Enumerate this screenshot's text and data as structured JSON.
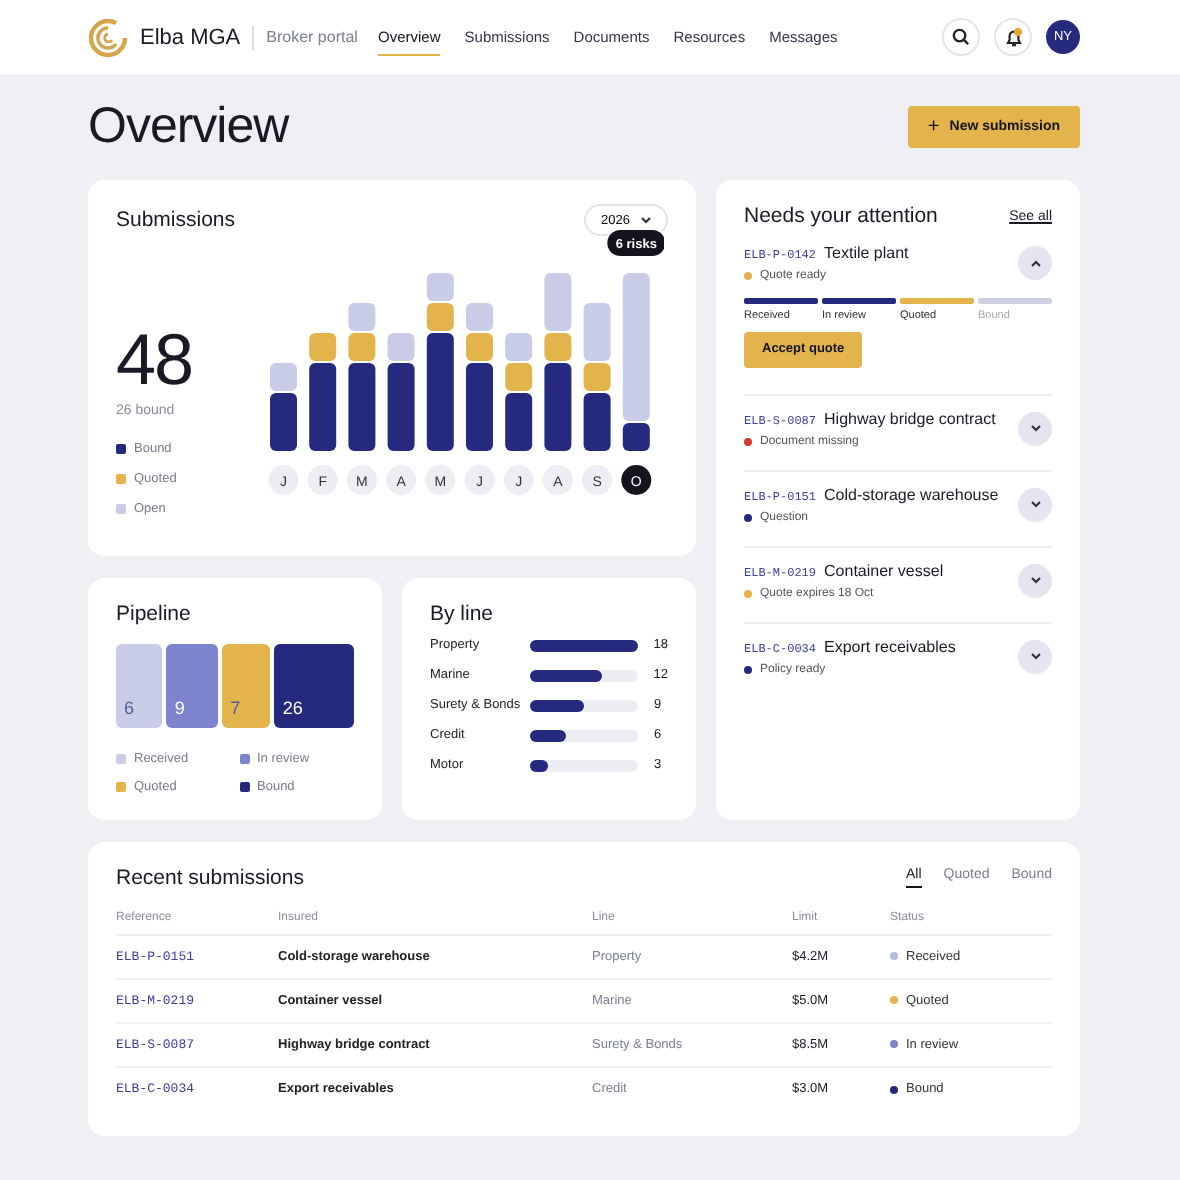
{
  "header": {
    "brand": "Elba MGA",
    "portal": "Broker portal",
    "nav": [
      {
        "label": "Overview",
        "selected": true
      },
      {
        "label": "Submissions",
        "selected": false
      },
      {
        "label": "Documents",
        "selected": false
      },
      {
        "label": "Resources",
        "selected": false
      },
      {
        "label": "Messages",
        "selected": false
      }
    ],
    "notifications_unread": true,
    "avatar": "NY"
  },
  "page": {
    "title": "Overview",
    "primary_action": "New submission",
    "primary_action_icon": "+"
  },
  "submissions": {
    "title": "Submissions",
    "year": "2026",
    "total": "48",
    "subtitle": "26 bound",
    "legend": [
      {
        "label": "Bound",
        "color": "#252a7e"
      },
      {
        "label": "Quoted",
        "color": "#e3b44b"
      },
      {
        "label": "Open",
        "color": "#c9cce6"
      }
    ],
    "months": [
      {
        "label": "J",
        "selected": false
      },
      {
        "label": "F",
        "selected": false
      },
      {
        "label": "M",
        "selected": false
      },
      {
        "label": "A",
        "selected": false
      },
      {
        "label": "M",
        "selected": false
      },
      {
        "label": "J",
        "selected": false
      },
      {
        "label": "J",
        "selected": false
      },
      {
        "label": "A",
        "selected": false
      },
      {
        "label": "S",
        "selected": false
      },
      {
        "label": "O",
        "selected": true
      }
    ],
    "tooltip": "6 risks"
  },
  "pipeline": {
    "title": "Pipeline",
    "stages": [
      {
        "label": "Received",
        "count": "6",
        "color": "#c9cce6"
      },
      {
        "label": "In review",
        "count": "9",
        "color": "#7d83cc"
      },
      {
        "label": "Quoted",
        "count": "7",
        "color": "#e3b44b"
      },
      {
        "label": "Bound",
        "count": "26",
        "color": "#252a7e"
      }
    ]
  },
  "by_line": {
    "title": "By line",
    "rows": [
      {
        "label": "Property",
        "level": 1,
        "count": "18"
      },
      {
        "label": "Marine",
        "level": 0.67,
        "count": "12"
      },
      {
        "label": "Surety & Bonds",
        "level": 0.5,
        "count": "9"
      },
      {
        "label": "Credit",
        "level": 0.33,
        "count": "6"
      },
      {
        "label": "Motor",
        "level": 0.17,
        "count": "3"
      }
    ]
  },
  "attention": {
    "title": "Needs your attention",
    "link": "See all",
    "items": [
      {
        "ref": "ELB-P-0142",
        "title": "Textile plant",
        "status": "Quote ready",
        "color": "#e3b44b",
        "expanded": true,
        "steps": [
          {
            "label": "Received",
            "done": true,
            "current": false
          },
          {
            "label": "In review",
            "done": true,
            "current": false
          },
          {
            "label": "Quoted",
            "done": false,
            "current": true
          },
          {
            "label": "Bound",
            "done": false,
            "current": false
          }
        ],
        "action": "Accept quote"
      },
      {
        "ref": "ELB-S-0087",
        "title": "Highway bridge contract",
        "status": "Document missing",
        "color": "#d2382c",
        "expanded": false
      },
      {
        "ref": "ELB-P-0151",
        "title": "Cold-storage warehouse",
        "status": "Question",
        "color": "#252a7e",
        "expanded": false
      },
      {
        "ref": "ELB-M-0219",
        "title": "Container vessel",
        "status": "Quote expires 18 Oct",
        "color": "#e3b44b",
        "expanded": false
      },
      {
        "ref": "ELB-C-0034",
        "title": "Export receivables",
        "status": "Policy ready",
        "color": "#252a7e",
        "expanded": false
      }
    ]
  },
  "recent": {
    "title": "Recent submissions",
    "filters": [
      {
        "label": "All",
        "selected": true
      },
      {
        "label": "Quoted",
        "selected": false
      },
      {
        "label": "Bound",
        "selected": false
      }
    ],
    "columns": [
      "Reference",
      "Insured",
      "Line",
      "Limit",
      "Status"
    ],
    "rows": [
      {
        "ref": "ELB-P-0151",
        "insured": "Cold-storage warehouse",
        "line": "Property",
        "limit": "$4.2M",
        "status": "Received",
        "color": "#b7bbe0"
      },
      {
        "ref": "ELB-M-0219",
        "insured": "Container vessel",
        "line": "Marine",
        "limit": "$5.0M",
        "status": "Quoted",
        "color": "#e3b44b"
      },
      {
        "ref": "ELB-S-0087",
        "insured": "Highway bridge contract",
        "line": "Surety & Bonds",
        "limit": "$8.5M",
        "status": "In review",
        "color": "#7d83cc"
      },
      {
        "ref": "ELB-C-0034",
        "insured": "Export receivables",
        "line": "Credit",
        "limit": "$3.0M",
        "status": "Bound",
        "color": "#252a7e"
      }
    ]
  }
}
